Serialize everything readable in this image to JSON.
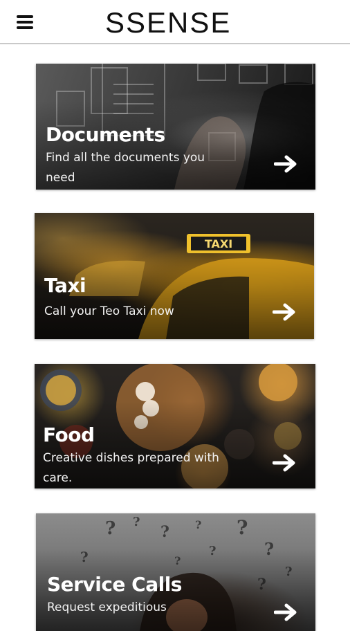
{
  "header": {
    "brand": "SSENSE",
    "menu_icon": "hamburger-menu-icon"
  },
  "cards": [
    {
      "title": "Documents",
      "description": "Find all the documents you need",
      "arrow_icon": "arrow-right-icon"
    },
    {
      "title": "Taxi",
      "description": "Call your Teo Taxi now",
      "arrow_icon": "arrow-right-icon"
    },
    {
      "title": "Food",
      "description": "Creative dishes prepared with care.",
      "arrow_icon": "arrow-right-icon"
    },
    {
      "title": "Service Calls",
      "description": "Request expeditious",
      "arrow_icon": "arrow-right-icon"
    }
  ]
}
